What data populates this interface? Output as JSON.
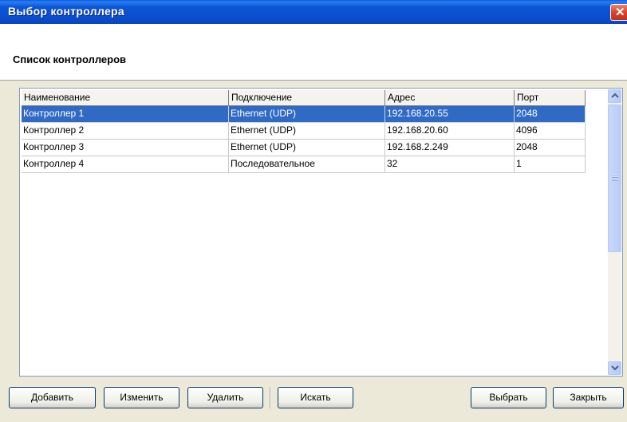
{
  "window": {
    "title": "Выбор контроллера",
    "close_glyph": "✕"
  },
  "header": {
    "title": "Список контроллеров"
  },
  "list": {
    "columns": [
      "Наименование",
      "Подключение",
      "Адрес",
      "Порт"
    ],
    "rows": [
      [
        "Контроллер 1",
        "Ethernet (UDP)",
        "192.168.20.55",
        "2048"
      ],
      [
        "Контроллер 2",
        "Ethernet (UDP)",
        "192.168.20.60",
        "4096"
      ],
      [
        "Контроллер 3",
        "Ethernet (UDP)",
        "192.168.2.249",
        "2048"
      ],
      [
        "Контроллер 4",
        "Последовательное",
        "32",
        "1"
      ]
    ],
    "selected_row": 0
  },
  "scrollbar": {
    "up_icon": "chevron-up-icon",
    "down_icon": "chevron-down-icon"
  },
  "buttons": {
    "add": "Добавить",
    "edit": "Изменить",
    "delete": "Удалить",
    "search": "Искать",
    "select": "Выбрать",
    "close": "Закрыть"
  },
  "colors": {
    "titlebar": "#0a55d4",
    "selection": "#316ac5",
    "dialog_bg": "#ece9d8"
  }
}
